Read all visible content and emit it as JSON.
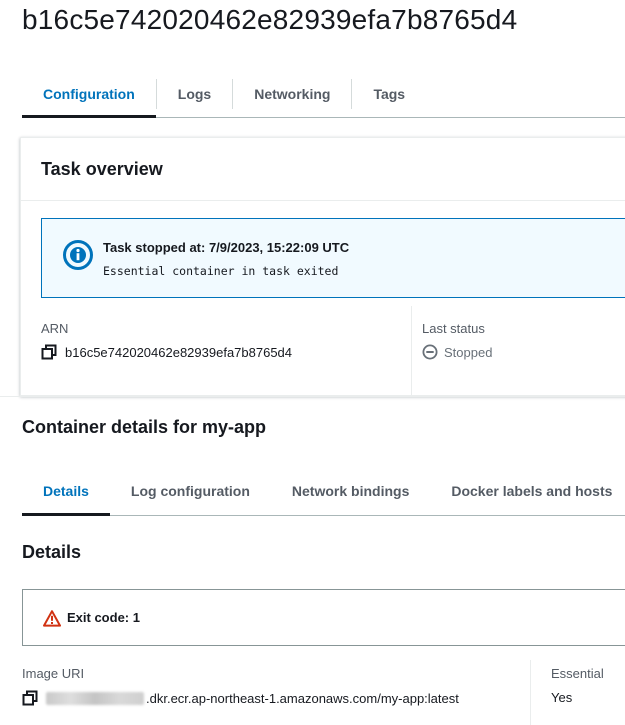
{
  "task": {
    "id": "b16c5e742020462e82939efa7b8765d4"
  },
  "main_tabs": [
    {
      "label": "Configuration",
      "active": true
    },
    {
      "label": "Logs",
      "active": false
    },
    {
      "label": "Networking",
      "active": false
    },
    {
      "label": "Tags",
      "active": false
    }
  ],
  "overview": {
    "title": "Task overview",
    "alert": {
      "icon": "info-circle-icon",
      "title": "Task stopped at: 7/9/2023, 15:22:09 UTC",
      "message": "Essential container in task exited"
    },
    "arn": {
      "label": "ARN",
      "value": "b16c5e742020462e82939efa7b8765d4"
    },
    "last_status": {
      "label": "Last status",
      "value": "Stopped"
    }
  },
  "container": {
    "title": "Container details for my-app",
    "tabs": [
      {
        "label": "Details",
        "active": true
      },
      {
        "label": "Log configuration",
        "active": false
      },
      {
        "label": "Network bindings",
        "active": false
      },
      {
        "label": "Docker labels and hosts",
        "active": false
      }
    ],
    "details_title": "Details",
    "exit": {
      "icon": "warning-icon",
      "text": "Exit code: 1"
    },
    "image_uri": {
      "label": "Image URI",
      "value_suffix": ".dkr.ecr.ap-northeast-1.amazonaws.com/my-app:latest"
    },
    "essential": {
      "label": "Essential",
      "value": "Yes"
    }
  },
  "colors": {
    "accent": "#0073bb",
    "info_bg": "#f1faff",
    "error": "#d13212",
    "muted_text": "#545b64"
  }
}
